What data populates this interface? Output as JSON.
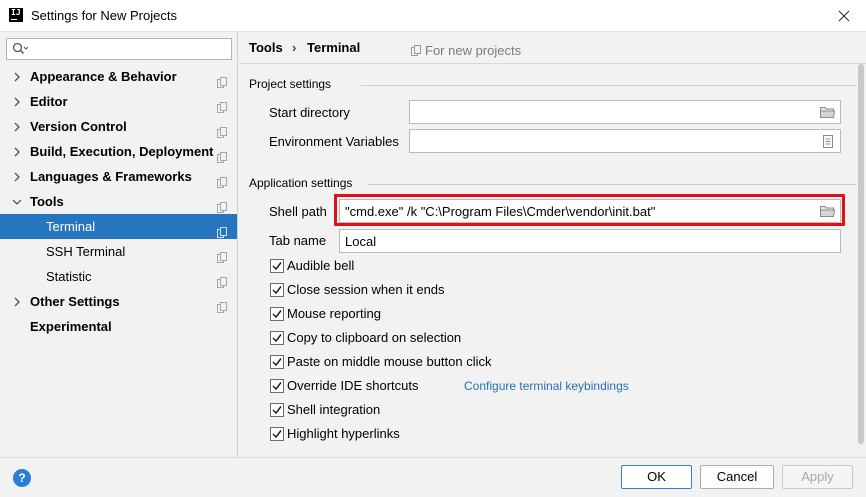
{
  "window": {
    "title": "Settings for New Projects",
    "app_icon_text": "IJ"
  },
  "sidebar": {
    "search_placeholder": "",
    "items": [
      {
        "label": "Appearance & Behavior",
        "expandable": true,
        "expanded": false,
        "child": false,
        "selected": false
      },
      {
        "label": "Editor",
        "expandable": true,
        "expanded": false,
        "child": false,
        "selected": false
      },
      {
        "label": "Version Control",
        "expandable": true,
        "expanded": false,
        "child": false,
        "selected": false
      },
      {
        "label": "Build, Execution, Deployment",
        "expandable": true,
        "expanded": false,
        "child": false,
        "selected": false
      },
      {
        "label": "Languages & Frameworks",
        "expandable": true,
        "expanded": false,
        "child": false,
        "selected": false
      },
      {
        "label": "Tools",
        "expandable": true,
        "expanded": true,
        "child": false,
        "selected": false
      },
      {
        "label": "Terminal",
        "expandable": false,
        "expanded": false,
        "child": true,
        "selected": true
      },
      {
        "label": "SSH Terminal",
        "expandable": false,
        "expanded": false,
        "child": true,
        "selected": false
      },
      {
        "label": "Statistic",
        "expandable": false,
        "expanded": false,
        "child": true,
        "selected": false
      },
      {
        "label": "Other Settings",
        "expandable": true,
        "expanded": false,
        "child": false,
        "selected": false
      },
      {
        "label": "Experimental",
        "expandable": false,
        "expanded": false,
        "child": false,
        "selected": false
      }
    ]
  },
  "breadcrumb": {
    "parent": "Tools",
    "separator": "›",
    "current": "Terminal",
    "scope_note": "For new projects"
  },
  "project_settings": {
    "title": "Project settings",
    "start_directory_label": "Start directory",
    "start_directory_value": "",
    "env_vars_label": "Environment Variables",
    "env_vars_value": ""
  },
  "application_settings": {
    "title": "Application settings",
    "shell_path_label": "Shell path",
    "shell_path_value": "\"cmd.exe\" /k \"C:\\Program Files\\Cmder\\vendor\\init.bat\"",
    "tab_name_label": "Tab name",
    "tab_name_value": "Local",
    "checkboxes": [
      {
        "label": "Audible bell",
        "checked": true
      },
      {
        "label": "Close session when it ends",
        "checked": true
      },
      {
        "label": "Mouse reporting",
        "checked": true
      },
      {
        "label": "Copy to clipboard on selection",
        "checked": true
      },
      {
        "label": "Paste on middle mouse button click",
        "checked": true
      },
      {
        "label": "Override IDE shortcuts",
        "checked": true
      },
      {
        "label": "Shell integration",
        "checked": true
      },
      {
        "label": "Highlight hyperlinks",
        "checked": true
      }
    ],
    "configure_link": "Configure terminal keybindings"
  },
  "footer": {
    "help_label": "?",
    "ok_label": "OK",
    "cancel_label": "Cancel",
    "apply_label": "Apply"
  },
  "colors": {
    "selection": "#2675bf",
    "highlight_border": "#e0101a",
    "link": "#2470b3",
    "help": "#2b7fd6"
  },
  "icons": {
    "search": "search-icon",
    "folder": "folder-icon",
    "document": "document-icon",
    "copy": "copy-icon",
    "check": "check-icon",
    "chevron_right": "chevron-right-icon",
    "chevron_down": "chevron-down-icon"
  }
}
